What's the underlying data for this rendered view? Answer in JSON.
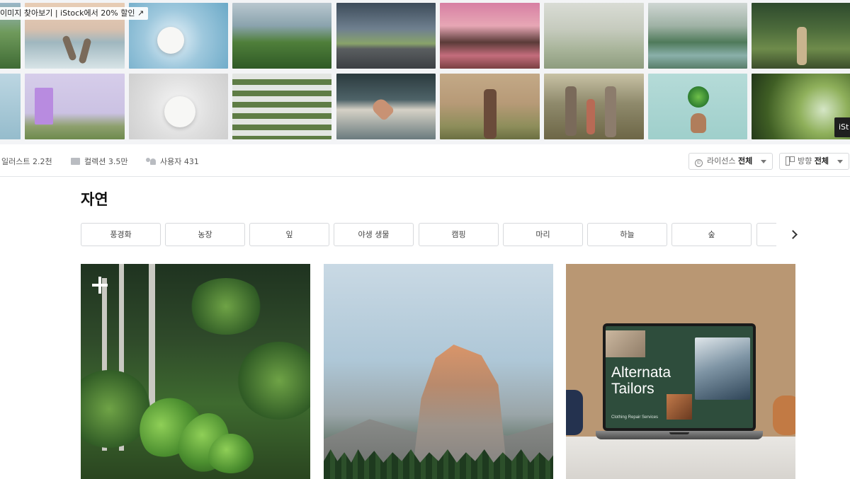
{
  "strip": {
    "banner_text": "이미지 찾아보기 | iStock에서 20% 할인 ↗",
    "istock_badge": "iSt"
  },
  "stats": {
    "illustrations": "일러스트 2.2천",
    "collections": "컬렉션 3.5만",
    "users": "사용자 431"
  },
  "filters": {
    "license_label": "라이선스",
    "license_value": "전체",
    "orientation_label": "방향",
    "orientation_value": "전체"
  },
  "section": {
    "title": "자연"
  },
  "chips": [
    "풍경화",
    "농장",
    "잎",
    "야생 생물",
    "캠핑",
    "마리",
    "하늘",
    "숲",
    ""
  ],
  "cards": {
    "laptop_title": "Alternata Tailors",
    "laptop_subtitle": "Clothing Repair Services"
  },
  "icons": {
    "license": "copyright-circle-icon",
    "orientation": "layout-icon",
    "collection": "folder-icon",
    "users": "users-icon",
    "next": "chevron-right-icon"
  },
  "colors": {
    "border": "#d7d9dc",
    "text": "#222222",
    "muted": "#555555"
  }
}
